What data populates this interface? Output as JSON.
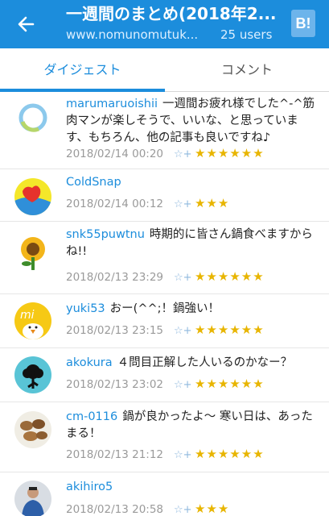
{
  "header": {
    "title": "一週間のまとめ(2018年2...",
    "domain": "www.nomunomutuk...",
    "users": "25 users",
    "hb_label": "B!"
  },
  "tabs": [
    {
      "label": "ダイジェスト",
      "active": true
    },
    {
      "label": "コメント",
      "active": false
    }
  ],
  "colors": {
    "accent": "#1C8DDC",
    "star": "#E8B500"
  },
  "comments": [
    {
      "user": "marumaruoishii",
      "text": "一週間お疲れ様でした^-^筋肉マンが楽しそうで、いいな、と思っています、もちろん、他の記事も良いですね♪",
      "date": "2018/02/14 00:20",
      "add_star": "☆+",
      "stars": "★★★★★★",
      "star_count": 6
    },
    {
      "user": "ColdSnap",
      "text": "",
      "date": "2018/02/14 00:12",
      "add_star": "☆+",
      "stars": "★★★",
      "star_count": 3
    },
    {
      "user": "snk55puwtnu",
      "text": "時期的に皆さん鍋食べますからね!!",
      "date": "2018/02/13 23:29",
      "add_star": "☆+",
      "stars": "★★★★★★",
      "star_count": 6
    },
    {
      "user": "yuki53",
      "text": "おー(^^;！鍋強い！",
      "date": "2018/02/13 23:15",
      "add_star": "☆+",
      "stars": "★★★★★★",
      "star_count": 6
    },
    {
      "user": "akokura",
      "text": "４問目正解した人いるのかなー？",
      "date": "2018/02/13 23:02",
      "add_star": "☆+",
      "stars": "★★★★★★",
      "star_count": 6
    },
    {
      "user": "cm-0116",
      "text": "鍋が良かったよ〜 寒い日は、あったまる！",
      "date": "2018/02/13 21:12",
      "add_star": "☆+",
      "stars": "★★★★★★",
      "star_count": 6
    },
    {
      "user": "akihiro5",
      "text": "",
      "date": "2018/02/13 20:58",
      "add_star": "☆+",
      "stars": "★★★",
      "star_count": 3
    }
  ]
}
